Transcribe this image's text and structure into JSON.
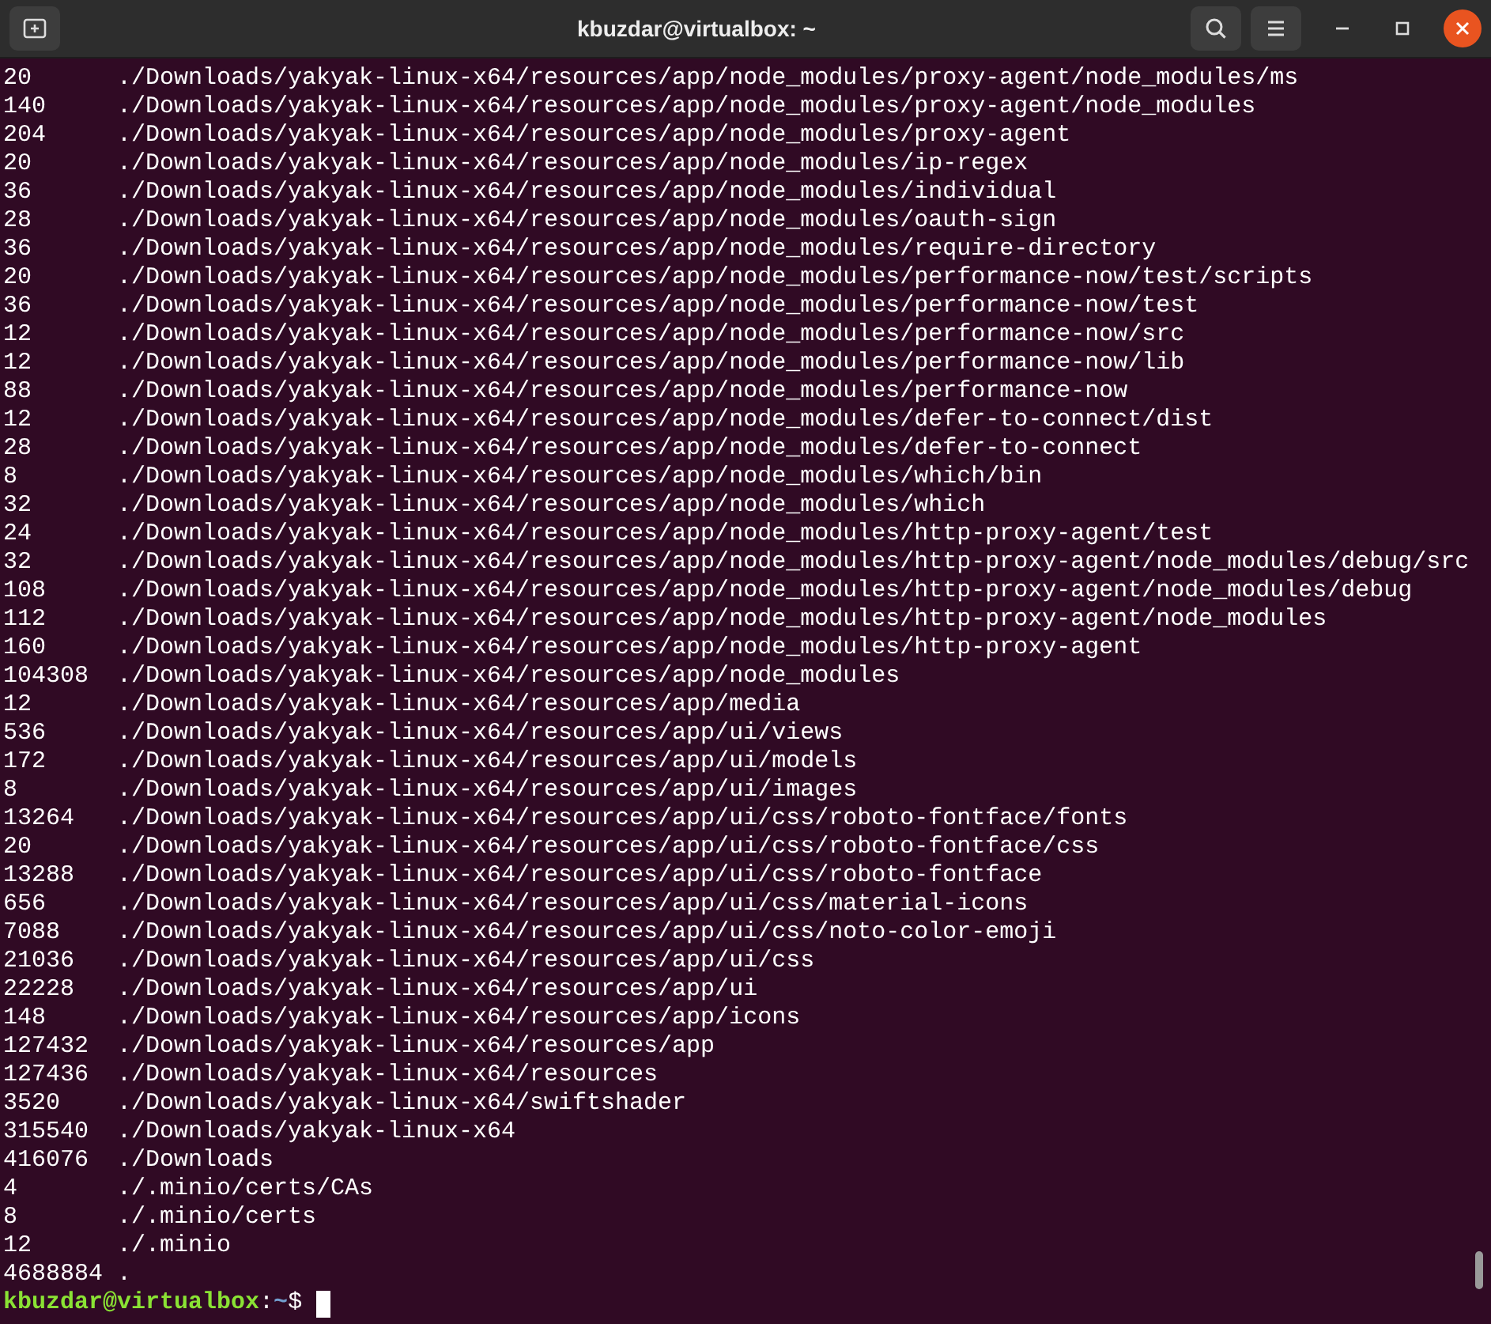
{
  "window": {
    "title": "kbuzdar@virtualbox: ~"
  },
  "output": [
    {
      "size": "20",
      "path": "./Downloads/yakyak-linux-x64/resources/app/node_modules/proxy-agent/node_modules/ms"
    },
    {
      "size": "140",
      "path": "./Downloads/yakyak-linux-x64/resources/app/node_modules/proxy-agent/node_modules"
    },
    {
      "size": "204",
      "path": "./Downloads/yakyak-linux-x64/resources/app/node_modules/proxy-agent"
    },
    {
      "size": "20",
      "path": "./Downloads/yakyak-linux-x64/resources/app/node_modules/ip-regex"
    },
    {
      "size": "36",
      "path": "./Downloads/yakyak-linux-x64/resources/app/node_modules/individual"
    },
    {
      "size": "28",
      "path": "./Downloads/yakyak-linux-x64/resources/app/node_modules/oauth-sign"
    },
    {
      "size": "36",
      "path": "./Downloads/yakyak-linux-x64/resources/app/node_modules/require-directory"
    },
    {
      "size": "20",
      "path": "./Downloads/yakyak-linux-x64/resources/app/node_modules/performance-now/test/scripts"
    },
    {
      "size": "36",
      "path": "./Downloads/yakyak-linux-x64/resources/app/node_modules/performance-now/test"
    },
    {
      "size": "12",
      "path": "./Downloads/yakyak-linux-x64/resources/app/node_modules/performance-now/src"
    },
    {
      "size": "12",
      "path": "./Downloads/yakyak-linux-x64/resources/app/node_modules/performance-now/lib"
    },
    {
      "size": "88",
      "path": "./Downloads/yakyak-linux-x64/resources/app/node_modules/performance-now"
    },
    {
      "size": "12",
      "path": "./Downloads/yakyak-linux-x64/resources/app/node_modules/defer-to-connect/dist"
    },
    {
      "size": "28",
      "path": "./Downloads/yakyak-linux-x64/resources/app/node_modules/defer-to-connect"
    },
    {
      "size": "8",
      "path": "./Downloads/yakyak-linux-x64/resources/app/node_modules/which/bin"
    },
    {
      "size": "32",
      "path": "./Downloads/yakyak-linux-x64/resources/app/node_modules/which"
    },
    {
      "size": "24",
      "path": "./Downloads/yakyak-linux-x64/resources/app/node_modules/http-proxy-agent/test"
    },
    {
      "size": "32",
      "path": "./Downloads/yakyak-linux-x64/resources/app/node_modules/http-proxy-agent/node_modules/debug/src"
    },
    {
      "size": "108",
      "path": "./Downloads/yakyak-linux-x64/resources/app/node_modules/http-proxy-agent/node_modules/debug"
    },
    {
      "size": "112",
      "path": "./Downloads/yakyak-linux-x64/resources/app/node_modules/http-proxy-agent/node_modules"
    },
    {
      "size": "160",
      "path": "./Downloads/yakyak-linux-x64/resources/app/node_modules/http-proxy-agent"
    },
    {
      "size": "104308",
      "path": "./Downloads/yakyak-linux-x64/resources/app/node_modules"
    },
    {
      "size": "12",
      "path": "./Downloads/yakyak-linux-x64/resources/app/media"
    },
    {
      "size": "536",
      "path": "./Downloads/yakyak-linux-x64/resources/app/ui/views"
    },
    {
      "size": "172",
      "path": "./Downloads/yakyak-linux-x64/resources/app/ui/models"
    },
    {
      "size": "8",
      "path": "./Downloads/yakyak-linux-x64/resources/app/ui/images"
    },
    {
      "size": "13264",
      "path": "./Downloads/yakyak-linux-x64/resources/app/ui/css/roboto-fontface/fonts"
    },
    {
      "size": "20",
      "path": "./Downloads/yakyak-linux-x64/resources/app/ui/css/roboto-fontface/css"
    },
    {
      "size": "13288",
      "path": "./Downloads/yakyak-linux-x64/resources/app/ui/css/roboto-fontface"
    },
    {
      "size": "656",
      "path": "./Downloads/yakyak-linux-x64/resources/app/ui/css/material-icons"
    },
    {
      "size": "7088",
      "path": "./Downloads/yakyak-linux-x64/resources/app/ui/css/noto-color-emoji"
    },
    {
      "size": "21036",
      "path": "./Downloads/yakyak-linux-x64/resources/app/ui/css"
    },
    {
      "size": "22228",
      "path": "./Downloads/yakyak-linux-x64/resources/app/ui"
    },
    {
      "size": "148",
      "path": "./Downloads/yakyak-linux-x64/resources/app/icons"
    },
    {
      "size": "127432",
      "path": "./Downloads/yakyak-linux-x64/resources/app"
    },
    {
      "size": "127436",
      "path": "./Downloads/yakyak-linux-x64/resources"
    },
    {
      "size": "3520",
      "path": "./Downloads/yakyak-linux-x64/swiftshader"
    },
    {
      "size": "315540",
      "path": "./Downloads/yakyak-linux-x64"
    },
    {
      "size": "416076",
      "path": "./Downloads"
    },
    {
      "size": "4",
      "path": "./.minio/certs/CAs"
    },
    {
      "size": "8",
      "path": "./.minio/certs"
    },
    {
      "size": "12",
      "path": "./.minio"
    },
    {
      "size": "4688884",
      "path": "."
    }
  ],
  "prompt": {
    "user_host": "kbuzdar@virtualbox",
    "separator": ":",
    "path": "~",
    "symbol": "$"
  }
}
